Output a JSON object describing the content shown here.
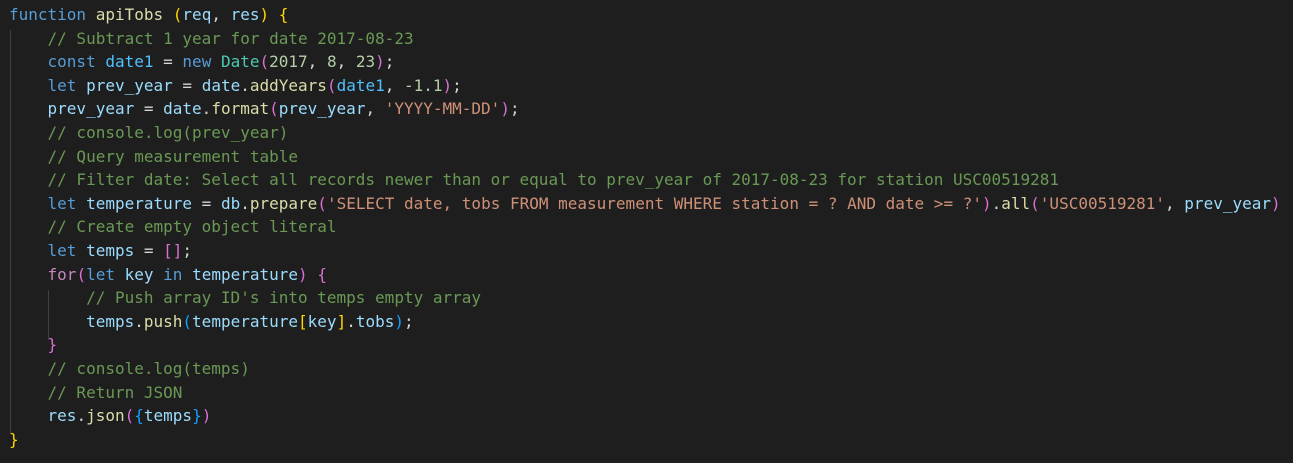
{
  "colors": {
    "background": "#1e1e1e",
    "keyword": "#569cd6",
    "control": "#c586c0",
    "function": "#dcdcaa",
    "variable": "#9cdcfe",
    "constant": "#4fc1ff",
    "type": "#4ec9b0",
    "string": "#ce9178",
    "number": "#b5cea8",
    "comment": "#6a9955",
    "punctuation": "#d4d4d4",
    "bracket_level1": "#ffd700",
    "bracket_level2": "#da70d6",
    "bracket_level3": "#179fff"
  },
  "code_lines": [
    [
      {
        "t": "kw",
        "v": "function"
      },
      {
        "t": "punc",
        "v": " "
      },
      {
        "t": "fn",
        "v": "apiTobs"
      },
      {
        "t": "punc",
        "v": " "
      },
      {
        "t": "b1",
        "v": "("
      },
      {
        "t": "var",
        "v": "req"
      },
      {
        "t": "punc",
        "v": ", "
      },
      {
        "t": "var",
        "v": "res"
      },
      {
        "t": "b1",
        "v": ")"
      },
      {
        "t": "punc",
        "v": " "
      },
      {
        "t": "b1",
        "v": "{"
      }
    ],
    [
      {
        "t": "punc",
        "v": "    "
      },
      {
        "t": "cm",
        "v": "// Subtract 1 year for date 2017-08-23"
      }
    ],
    [
      {
        "t": "punc",
        "v": "    "
      },
      {
        "t": "kw",
        "v": "const"
      },
      {
        "t": "punc",
        "v": " "
      },
      {
        "t": "const",
        "v": "date1"
      },
      {
        "t": "punc",
        "v": " = "
      },
      {
        "t": "kw",
        "v": "new"
      },
      {
        "t": "punc",
        "v": " "
      },
      {
        "t": "type",
        "v": "Date"
      },
      {
        "t": "b2",
        "v": "("
      },
      {
        "t": "num",
        "v": "2017"
      },
      {
        "t": "punc",
        "v": ", "
      },
      {
        "t": "num",
        "v": "8"
      },
      {
        "t": "punc",
        "v": ", "
      },
      {
        "t": "num",
        "v": "23"
      },
      {
        "t": "b2",
        "v": ")"
      },
      {
        "t": "punc",
        "v": ";"
      }
    ],
    [
      {
        "t": "punc",
        "v": "    "
      },
      {
        "t": "kw",
        "v": "let"
      },
      {
        "t": "punc",
        "v": " "
      },
      {
        "t": "var",
        "v": "prev_year"
      },
      {
        "t": "punc",
        "v": " = "
      },
      {
        "t": "var",
        "v": "date"
      },
      {
        "t": "punc",
        "v": "."
      },
      {
        "t": "fn",
        "v": "addYears"
      },
      {
        "t": "b2",
        "v": "("
      },
      {
        "t": "const",
        "v": "date1"
      },
      {
        "t": "punc",
        "v": ", "
      },
      {
        "t": "num",
        "v": "-1.1"
      },
      {
        "t": "b2",
        "v": ")"
      },
      {
        "t": "punc",
        "v": ";"
      }
    ],
    [
      {
        "t": "punc",
        "v": "    "
      },
      {
        "t": "var",
        "v": "prev_year"
      },
      {
        "t": "punc",
        "v": " = "
      },
      {
        "t": "var",
        "v": "date"
      },
      {
        "t": "punc",
        "v": "."
      },
      {
        "t": "fn",
        "v": "format"
      },
      {
        "t": "b2",
        "v": "("
      },
      {
        "t": "var",
        "v": "prev_year"
      },
      {
        "t": "punc",
        "v": ", "
      },
      {
        "t": "str",
        "v": "'YYYY-MM-DD'"
      },
      {
        "t": "b2",
        "v": ")"
      },
      {
        "t": "punc",
        "v": ";"
      }
    ],
    [
      {
        "t": "punc",
        "v": "    "
      },
      {
        "t": "cm",
        "v": "// console.log(prev_year)"
      }
    ],
    [
      {
        "t": "punc",
        "v": "    "
      },
      {
        "t": "cm",
        "v": "// Query measurement table"
      }
    ],
    [
      {
        "t": "punc",
        "v": "    "
      },
      {
        "t": "cm",
        "v": "// Filter date: Select all records newer than or equal to prev_year of 2017-08-23 for station USC00519281"
      }
    ],
    [
      {
        "t": "punc",
        "v": "    "
      },
      {
        "t": "kw",
        "v": "let"
      },
      {
        "t": "punc",
        "v": " "
      },
      {
        "t": "var",
        "v": "temperature"
      },
      {
        "t": "punc",
        "v": " = "
      },
      {
        "t": "var",
        "v": "db"
      },
      {
        "t": "punc",
        "v": "."
      },
      {
        "t": "fn",
        "v": "prepare"
      },
      {
        "t": "b2",
        "v": "("
      },
      {
        "t": "str",
        "v": "'SELECT date, tobs FROM measurement WHERE station = ? AND date >= ?'"
      },
      {
        "t": "b2",
        "v": ")"
      },
      {
        "t": "punc",
        "v": "."
      },
      {
        "t": "fn",
        "v": "all"
      },
      {
        "t": "b2",
        "v": "("
      },
      {
        "t": "str",
        "v": "'USC00519281'"
      },
      {
        "t": "punc",
        "v": ", "
      },
      {
        "t": "var",
        "v": "prev_year"
      },
      {
        "t": "b2",
        "v": ")"
      }
    ],
    [
      {
        "t": "punc",
        "v": "    "
      },
      {
        "t": "cm",
        "v": "// Create empty object literal"
      }
    ],
    [
      {
        "t": "punc",
        "v": "    "
      },
      {
        "t": "kw",
        "v": "let"
      },
      {
        "t": "punc",
        "v": " "
      },
      {
        "t": "var",
        "v": "temps"
      },
      {
        "t": "punc",
        "v": " = "
      },
      {
        "t": "b2",
        "v": "[]"
      },
      {
        "t": "punc",
        "v": ";"
      }
    ],
    [
      {
        "t": "punc",
        "v": "    "
      },
      {
        "t": "ctl",
        "v": "for"
      },
      {
        "t": "b2",
        "v": "("
      },
      {
        "t": "kw",
        "v": "let"
      },
      {
        "t": "punc",
        "v": " "
      },
      {
        "t": "var",
        "v": "key"
      },
      {
        "t": "punc",
        "v": " "
      },
      {
        "t": "kw",
        "v": "in"
      },
      {
        "t": "punc",
        "v": " "
      },
      {
        "t": "var",
        "v": "temperature"
      },
      {
        "t": "b2",
        "v": ")"
      },
      {
        "t": "punc",
        "v": " "
      },
      {
        "t": "b2",
        "v": "{"
      }
    ],
    [
      {
        "t": "punc",
        "v": "        "
      },
      {
        "t": "cm",
        "v": "// Push array ID's into temps empty array"
      }
    ],
    [
      {
        "t": "punc",
        "v": "        "
      },
      {
        "t": "var",
        "v": "temps"
      },
      {
        "t": "punc",
        "v": "."
      },
      {
        "t": "fn",
        "v": "push"
      },
      {
        "t": "b3",
        "v": "("
      },
      {
        "t": "var",
        "v": "temperature"
      },
      {
        "t": "b1",
        "v": "["
      },
      {
        "t": "var",
        "v": "key"
      },
      {
        "t": "b1",
        "v": "]"
      },
      {
        "t": "punc",
        "v": "."
      },
      {
        "t": "var",
        "v": "tobs"
      },
      {
        "t": "b3",
        "v": ")"
      },
      {
        "t": "punc",
        "v": ";"
      }
    ],
    [
      {
        "t": "punc",
        "v": "    "
      },
      {
        "t": "b2",
        "v": "}"
      }
    ],
    [
      {
        "t": "punc",
        "v": "    "
      },
      {
        "t": "cm",
        "v": "// console.log(temps)"
      }
    ],
    [
      {
        "t": "punc",
        "v": "    "
      },
      {
        "t": "cm",
        "v": "// Return JSON"
      }
    ],
    [
      {
        "t": "punc",
        "v": "    "
      },
      {
        "t": "var",
        "v": "res"
      },
      {
        "t": "punc",
        "v": "."
      },
      {
        "t": "fn",
        "v": "json"
      },
      {
        "t": "b2",
        "v": "("
      },
      {
        "t": "b3",
        "v": "{"
      },
      {
        "t": "var",
        "v": "temps"
      },
      {
        "t": "b3",
        "v": "}"
      },
      {
        "t": "b2",
        "v": ")"
      }
    ],
    [
      {
        "t": "b1",
        "v": "}"
      }
    ]
  ]
}
